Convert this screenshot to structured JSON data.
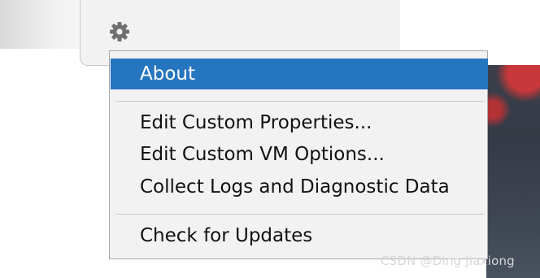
{
  "settings_button": {
    "icon": "gear-icon"
  },
  "menu": {
    "items": [
      {
        "label": "About"
      },
      {
        "label": "Edit Custom Properties..."
      },
      {
        "label": "Edit Custom VM Options..."
      },
      {
        "label": "Collect Logs and Diagnostic Data"
      },
      {
        "label": "Check for Updates"
      }
    ],
    "selected_color": "#2675bf"
  },
  "watermark": {
    "text": "CSDN @Ding Jiaxiong"
  }
}
